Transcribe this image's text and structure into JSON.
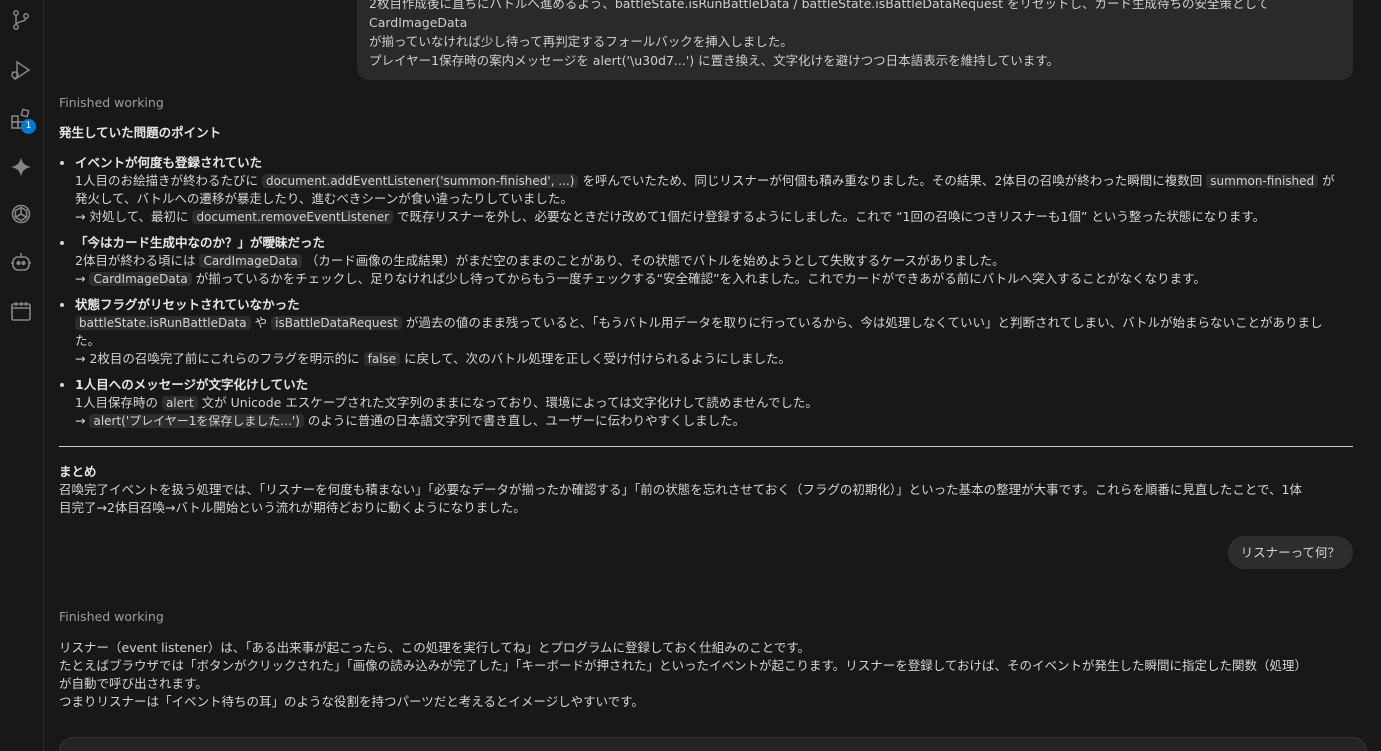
{
  "activity_bar": {
    "icons": [
      "source-control-icon",
      "run-debug-icon",
      "extensions-icon",
      "sparkle-icon",
      "openai-icon",
      "robot-icon",
      "calendar-icon"
    ],
    "extensions_badge": "1"
  },
  "prev_user_message": {
    "line1": "2枚目作成後に直ちにバトルへ進めるよう、battleState.isRunBattleData / battleState.isBattleDataRequest をリセットし、カード生成待ちの安全策として CardImageData",
    "line2": "が揃っていなければ少し待って再判定するフォールバックを挿入しました。",
    "line3": "プレイヤー1保存時の案内メッセージを alert('\\u30d7...') に置き換え、文字化けを避けつつ日本語表示を維持しています。"
  },
  "response1": {
    "status": "Finished working",
    "heading": "発生していた問題のポイント",
    "items": [
      {
        "title": "イベントが何度も登録されていた",
        "l1_a": "1人目のお絵描きが終わるたびに",
        "l1_code1": "document.addEventListener('summon-finished', ...)",
        "l1_b": "を呼んでいたため、同じリスナーが何個も積み重なりました。その結果、2体目の召喚が終わった瞬間に複数回",
        "l1_code2": "summon-finished",
        "l1_c": "が",
        "l2": "発火して、バトルへの遷移が暴走したり、進むべきシーンが食い違ったりしていました。",
        "l3_a": "→ 対処して、最初に",
        "l3_code": "document.removeEventListener",
        "l3_b": "で既存リスナーを外し、必要なときだけ改めて1個だけ登録するようにしました。これで “1回の召喚につきリスナーも1個” という整った状態になります。"
      },
      {
        "title": "「今はカード生成中なのか？」が曖昧だった",
        "l1_a": "2体目が終わる頃には",
        "l1_code": "CardImageData",
        "l1_b": "（カード画像の生成結果）がまだ空のままのことがあり、その状態でバトルを始めようとして失敗するケースがありました。",
        "l2_a": "→",
        "l2_code": "CardImageData",
        "l2_b": "が揃っているかをチェックし、足りなければ少し待ってからもう一度チェックする“安全確認”を入れました。これでカードができあがる前にバトルへ突入することがなくなります。"
      },
      {
        "title": "状態フラグがリセットされていなかった",
        "l1_code1": "battleState.isRunBattleData",
        "l1_a": "や",
        "l1_code2": "isBattleDataRequest",
        "l1_b": "が過去の値のまま残っていると、「もうバトル用データを取りに行っているから、今は処理しなくていい」と判断されてしまい、バトルが始まらないことがありまし",
        "l2": "た。",
        "l3_a": "→ 2枚目の召喚完了前にこれらのフラグを明示的に",
        "l3_code": "false",
        "l3_b": "に戻して、次のバトル処理を正しく受け付けられるようにしました。"
      },
      {
        "title": "1人目へのメッセージが文字化けしていた",
        "l1_a": "1人目保存時の",
        "l1_code": "alert",
        "l1_b": "文が Unicode エスケープされた文字列のままになっており、環境によっては文字化けして読めませんでした。",
        "l2_a": "→",
        "l2_code": "alert('プレイヤー1を保存しました...')",
        "l2_b": "のように普通の日本語文字列で書き直し、ユーザーに伝わりやすくしました。"
      }
    ],
    "summary_heading": "まとめ",
    "summary_l1": "召喚完了イベントを扱う処理では、「リスナーを何度も積まない」「必要なデータが揃ったか確認する」「前の状態を忘れさせておく（フラグの初期化）」といった基本の整理が大事です。これらを順番に見直したことで、1体",
    "summary_l2": "目完了→2体目召喚→バトル開始という流れが期待どおりに動くようになりました。"
  },
  "user_question": "リスナーって何？",
  "response2": {
    "status": "Finished working",
    "p1": "リスナー（event listener）は、「ある出来事が起こったら、この処理を実行してね」とプログラムに登録しておく仕組みのことです。",
    "p2a": "たとえばブラウザでは「ボタンがクリックされた」「画像の読み込みが完了した」「キーボードが押された」といったイベントが起こります。リスナーを登録しておけば、そのイベントが発生した瞬間に指定した関数（処理）",
    "p2b": "が自動で呼び出されます。",
    "p3": "つまりリスナーは「イベント待ちの耳」のような役割を持つパーツだと考えるとイメージしやすいです。"
  }
}
